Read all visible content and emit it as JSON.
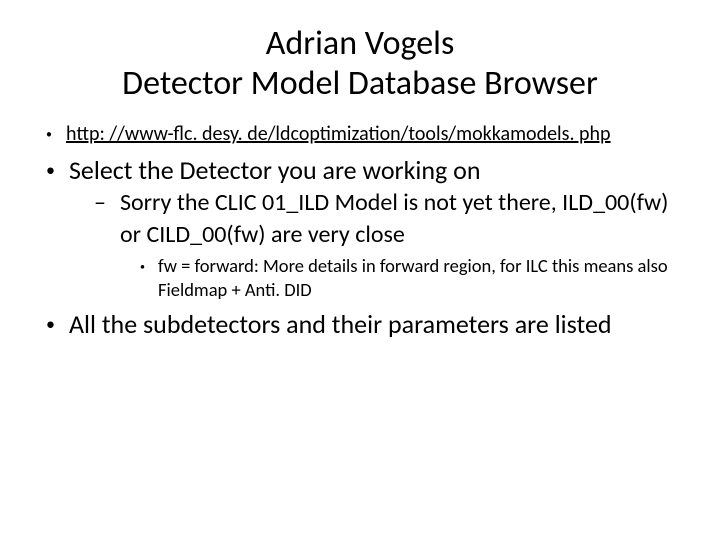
{
  "title": {
    "line1": "Adrian Vogels",
    "line2": "Detector Model Database Browser"
  },
  "bullets": {
    "link_url": "http: //www-flc. desy. de/ldcoptimization/tools/mokkamodels. php",
    "b1": "Select the Detector you are working on",
    "b1_sub": "Sorry the CLIC 01_ILD Model is not yet there, ILD_00(fw) or CILD_00(fw) are very close",
    "b1_sub_sub": "fw = forward: More details in forward region, for ILC this means also Fieldmap + Anti. DID",
    "b2": "All the subdetectors and their parameters are listed"
  }
}
